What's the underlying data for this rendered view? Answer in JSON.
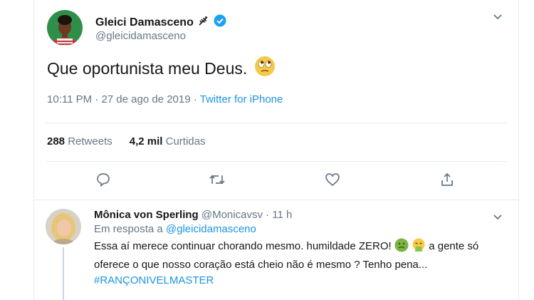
{
  "tweet": {
    "display_name": "Gleici Damasceno",
    "feather_icon": "feather-icon",
    "handle": "@gleicidamasceno",
    "text": "Que oportunista meu Deus.",
    "emoji": "face-with-rolling-eyes",
    "time": "10:11 PM",
    "date": "27 de ago de 2019",
    "separator": "·",
    "source": "Twitter for iPhone",
    "retweets_count": "288",
    "retweets_label": "Retweets",
    "likes_count": "4,2 mil",
    "likes_label": "Curtidas"
  },
  "actions": [
    "reply-icon",
    "retweet-icon",
    "like-icon",
    "share-icon"
  ],
  "reply": {
    "display_name": "Mônica von Sperling",
    "handle": "@Monicavsv",
    "separator": "·",
    "age": "11 h",
    "in_reply_prefix": "Em resposta a",
    "in_reply_handle": "@gleicidamasceno",
    "text_part1": "Essa aí merece continuar chorando mesmo. humildade ZERO!",
    "text_part2": "a gente só oferece o que nosso coração está cheio não é mesmo ? Tenho pena...",
    "hashtag": "#RANÇONIVELMASTER",
    "emojis": [
      "nauseated-face",
      "face-vomiting"
    ]
  },
  "colors": {
    "link": "#1b95e0",
    "muted": "#657786",
    "text": "#14171a",
    "verified": "#1da1f2"
  }
}
